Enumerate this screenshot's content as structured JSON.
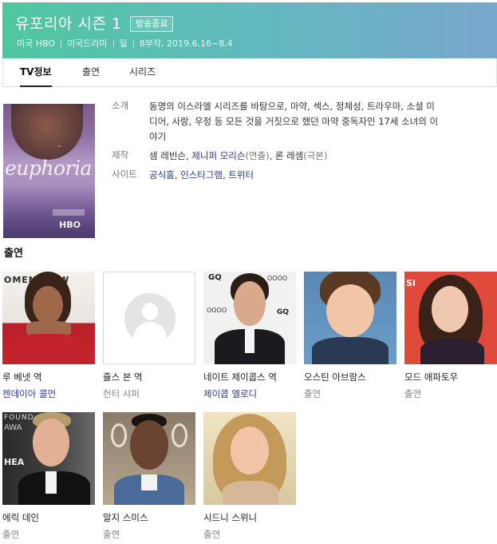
{
  "header": {
    "title": "유포리아 시즌 1",
    "badge": "방송종료",
    "meta": [
      "미국 HBO",
      "미국드라마",
      "일",
      "8부작, 2019.6.16~8.4"
    ],
    "colors": {
      "gradient_start": "#50c6a0",
      "gradient_end": "#7aa6cc"
    }
  },
  "tabs": [
    {
      "label": "TV정보",
      "active": true
    },
    {
      "label": "출연",
      "active": false
    },
    {
      "label": "시리즈",
      "active": false
    }
  ],
  "poster": {
    "word": "euphoria",
    "network": "HBO"
  },
  "info": {
    "intro_key": "소개",
    "intro_line1": "동명의 이스라엘 시리즈를 바탕으로, 마약, 섹스, 정체성, 트라우마, 소셜 미",
    "intro_line2": "디어, 사랑, 우정 등 모든 것을 거짓으로 했던 마약 중독자인 17세 소녀의 이",
    "intro_line3": "야기",
    "production_key": "제작",
    "production": {
      "p1_name": "샘 레빈슨",
      "p1_sep": ",",
      "p2_name": "제니퍼 모리슨",
      "p2_role": "(연출)",
      "p2_sep": ",",
      "p3_name": "론 레셈",
      "p3_role": "(극본)"
    },
    "site_key": "사이트",
    "sites": {
      "s1": "공식홈",
      "sep1": ",",
      "s2": "인스타그램",
      "sep2": ",",
      "s3": "트위터"
    }
  },
  "cast_section_title": "출연",
  "cast": [
    {
      "role": "루 베넷 역",
      "actor": "젠데이아 콜먼",
      "link": true
    },
    {
      "role": "쥴스 본 역",
      "actor": "헌터 샤퍼",
      "link": false
    },
    {
      "role": "네이트 제이콥스 역",
      "actor": "제이콥 엘로디",
      "link": true
    },
    {
      "role": "오스틴 아브람스",
      "actor": "출연",
      "link": false
    },
    {
      "role": "모드 애파토우",
      "actor": "출연",
      "link": false
    },
    {
      "role": "에릭 데인",
      "actor": "출연",
      "link": false
    },
    {
      "role": "알지 스미스",
      "actor": "출연",
      "link": false
    },
    {
      "role": "시드니 스위니",
      "actor": "출연",
      "link": false
    }
  ]
}
